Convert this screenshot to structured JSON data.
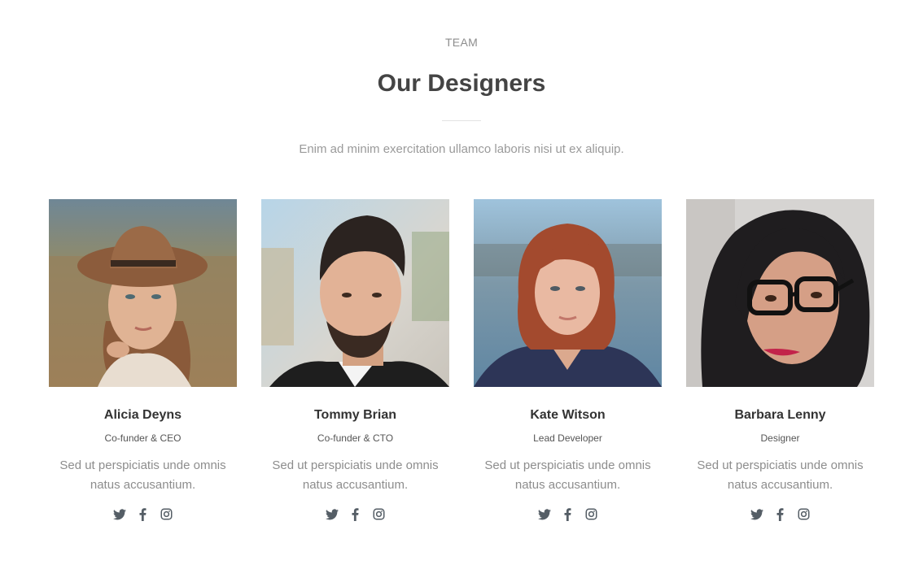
{
  "header": {
    "eyebrow": "TEAM",
    "title": "Our Designers",
    "subtitle": "Enim ad minim exercitation ullamco laboris nisi ut ex aliquip."
  },
  "colors": {
    "heading": "#444444",
    "muted": "#8d8d8d",
    "icon": "#555e66"
  },
  "team": [
    {
      "name": "Alicia Deyns",
      "role": "Co-funder & CEO",
      "bio": "Sed ut perspiciatis unde omnis natus accusantium.",
      "socials": [
        "twitter-icon",
        "facebook-icon",
        "instagram-icon"
      ]
    },
    {
      "name": "Tommy Brian",
      "role": "Co-funder & CTO",
      "bio": "Sed ut perspiciatis unde omnis natus accusantium.",
      "socials": [
        "twitter-icon",
        "facebook-icon",
        "instagram-icon"
      ]
    },
    {
      "name": "Kate Witson",
      "role": "Lead Developer",
      "bio": "Sed ut perspiciatis unde omnis natus accusantium.",
      "socials": [
        "twitter-icon",
        "facebook-icon",
        "instagram-icon"
      ]
    },
    {
      "name": "Barbara Lenny",
      "role": "Designer",
      "bio": "Sed ut perspiciatis unde omnis natus accusantium.",
      "socials": [
        "twitter-icon",
        "facebook-icon",
        "instagram-icon"
      ]
    }
  ]
}
